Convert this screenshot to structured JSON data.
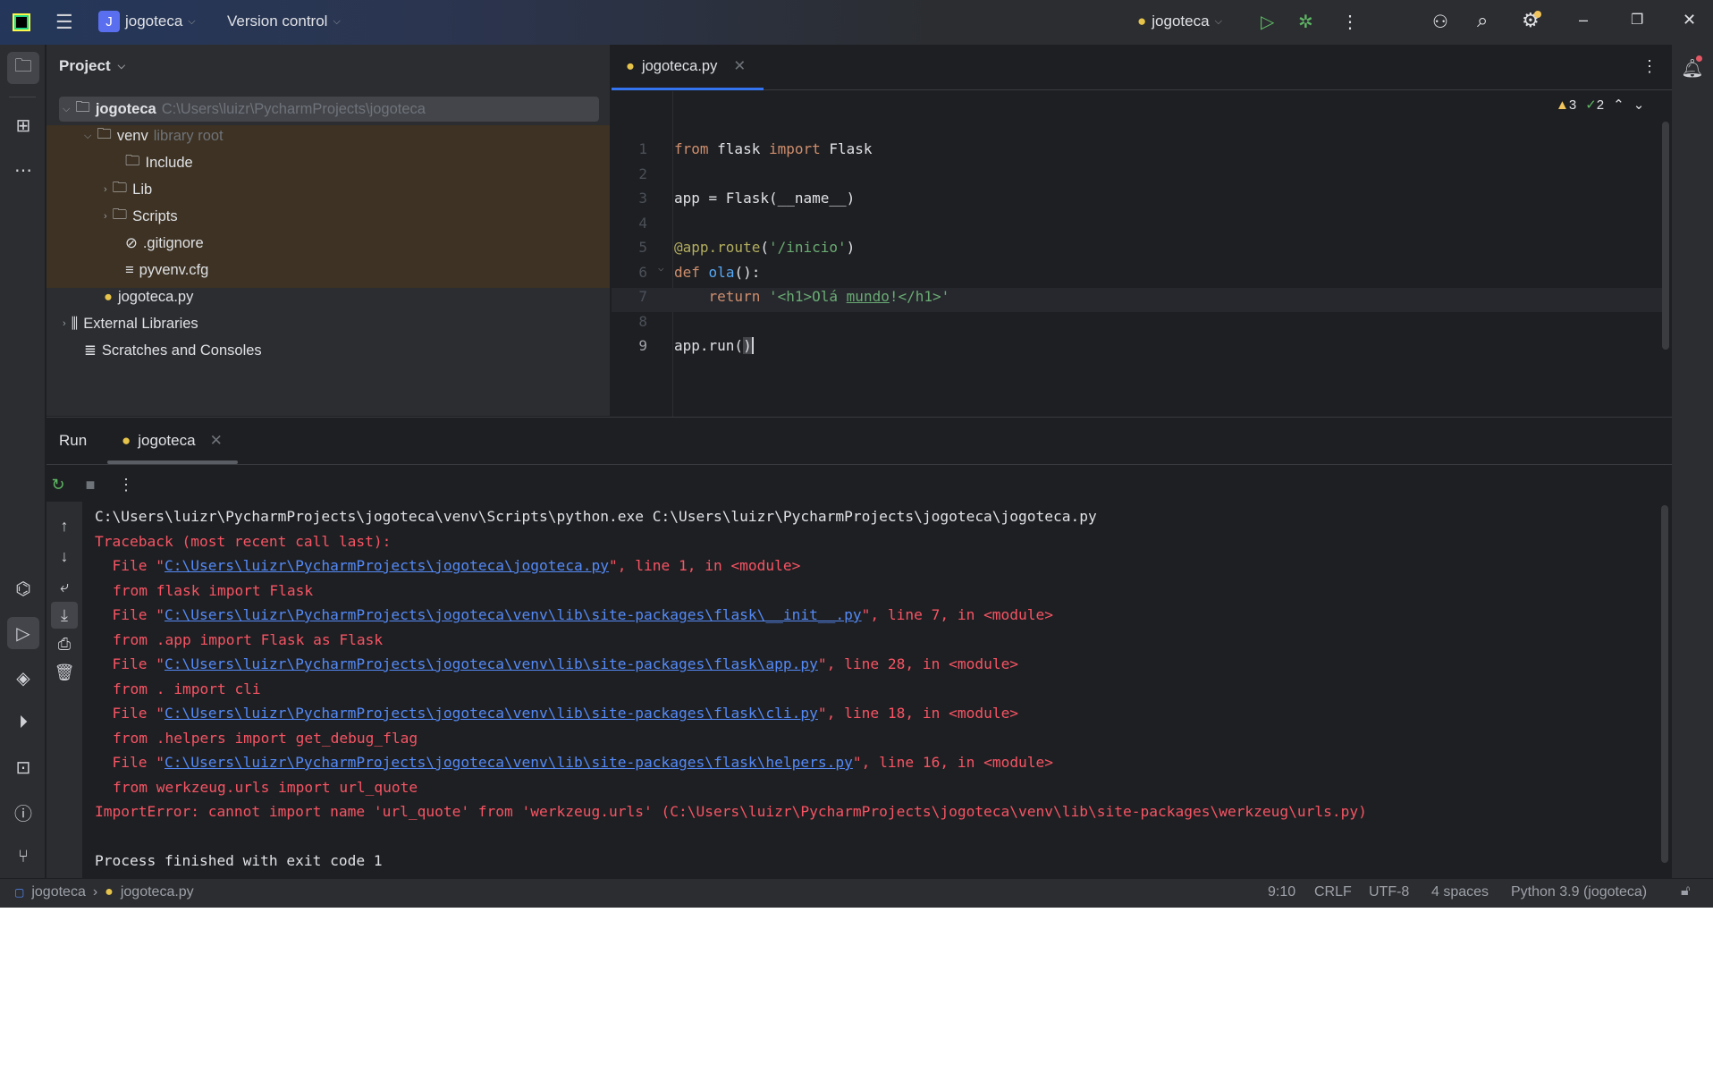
{
  "titlebar": {
    "project_initial": "J",
    "project": "jogoteca",
    "vcs": "Version control",
    "run_config": "jogoteca"
  },
  "project_panel": {
    "title": "Project",
    "tree": [
      {
        "label": "jogoteca",
        "hint": "C:\\Users\\luizr\\PycharmProjects\\jogoteca"
      },
      {
        "label": "venv",
        "hint": "library root"
      },
      {
        "label": "Include"
      },
      {
        "label": "Lib"
      },
      {
        "label": "Scripts"
      },
      {
        "label": ".gitignore"
      },
      {
        "label": "pyvenv.cfg"
      },
      {
        "label": "jogoteca.py"
      },
      {
        "label": "External Libraries"
      },
      {
        "label": "Scratches and Consoles"
      }
    ]
  },
  "editor": {
    "tab": "jogoteca.py",
    "warnings": "3",
    "ok": "2",
    "lines": [
      "1",
      "2",
      "3",
      "4",
      "5",
      "6",
      "7",
      "8",
      "9"
    ]
  },
  "run": {
    "title": "Run",
    "tab": "jogoteca",
    "console": {
      "cmd": "C:\\Users\\luizr\\PycharmProjects\\jogoteca\\venv\\Scripts\\python.exe C:\\Users\\luizr\\PycharmProjects\\jogoteca\\jogoteca.py",
      "traceback": "Traceback (most recent call last):",
      "frames": [
        {
          "path": "C:\\Users\\luizr\\PycharmProjects\\jogoteca\\jogoteca.py",
          "suffix": "\", line 1, in <module>",
          "code": "from flask import Flask"
        },
        {
          "path": "C:\\Users\\luizr\\PycharmProjects\\jogoteca\\venv\\lib\\site-packages\\flask\\__init__.py",
          "suffix": "\", line 7, in <module>",
          "code": "from .app import Flask as Flask"
        },
        {
          "path": "C:\\Users\\luizr\\PycharmProjects\\jogoteca\\venv\\lib\\site-packages\\flask\\app.py",
          "suffix": "\", line 28, in <module>",
          "code": "from . import cli"
        },
        {
          "path": "C:\\Users\\luizr\\PycharmProjects\\jogoteca\\venv\\lib\\site-packages\\flask\\cli.py",
          "suffix": "\", line 18, in <module>",
          "code": "from .helpers import get_debug_flag"
        },
        {
          "path": "C:\\Users\\luizr\\PycharmProjects\\jogoteca\\venv\\lib\\site-packages\\flask\\helpers.py",
          "suffix": "\", line 16, in <module>",
          "code": "from werkzeug.urls import url_quote"
        }
      ],
      "file_prefix": "  File \"",
      "error": "ImportError: cannot import name 'url_quote' from 'werkzeug.urls' (C:\\Users\\luizr\\PycharmProjects\\jogoteca\\venv\\lib\\site-packages\\werkzeug\\urls.py)",
      "exit": "Process finished with exit code 1"
    }
  },
  "status": {
    "crumb_project": "jogoteca",
    "crumb_file": "jogoteca.py",
    "position": "9:10",
    "line_sep": "CRLF",
    "encoding": "UTF-8",
    "indent": "4 spaces",
    "interpreter": "Python 3.9 (jogoteca)"
  },
  "colors": {
    "accent": "#3574f0",
    "error": "#f75464",
    "link": "#548af7",
    "run": "#5fb865"
  }
}
